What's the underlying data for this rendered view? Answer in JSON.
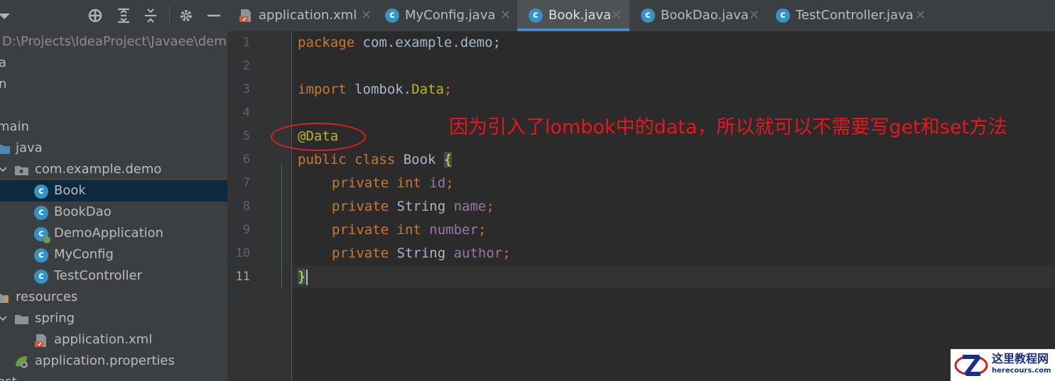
{
  "project": {
    "path": "D:\\Projects\\IdeaProject\\Javaee\\demo",
    "rows": [
      {
        "label": "a"
      },
      {
        "label": "n"
      },
      {
        "label": "main"
      },
      {
        "label": "java"
      },
      {
        "label": "com.example.demo"
      },
      {
        "label": "Book"
      },
      {
        "label": "BookDao"
      },
      {
        "label": "DemoApplication"
      },
      {
        "label": "MyConfig"
      },
      {
        "label": "TestController"
      },
      {
        "label": "resources"
      },
      {
        "label": "spring"
      },
      {
        "label": "application.xml"
      },
      {
        "label": "application.properties"
      },
      {
        "label": "est"
      }
    ]
  },
  "tabs": [
    {
      "label": "application.xml",
      "icon": "xml-file-icon"
    },
    {
      "label": "MyConfig.java",
      "icon": "java-class-icon"
    },
    {
      "label": "Book.java",
      "icon": "java-class-icon",
      "active": true
    },
    {
      "label": "BookDao.java",
      "icon": "java-class-icon"
    },
    {
      "label": "TestController.java",
      "icon": "java-class-icon"
    }
  ],
  "editor": {
    "line_numbers": [
      "1",
      "2",
      "3",
      "4",
      "5",
      "6",
      "7",
      "8",
      "9",
      "10",
      "11"
    ],
    "current_line": "11",
    "code": {
      "l1_kw": "package",
      "l1_rest": " com.example.demo;",
      "l3_kw": "import",
      "l3_mid": " lombok.",
      "l3_ann": "Data",
      "l3_end": ";",
      "l5_ann": "@Data",
      "l6_kw": "public class",
      "l6_name": " Book ",
      "l6_brace": "{",
      "l7_kw": "private int",
      "l7_fld": "id",
      "l8_kw": "private",
      "l8_type": " String ",
      "l8_fld": "name",
      "l9_kw": "private int",
      "l9_fld": "number",
      "l10_kw": "private",
      "l10_type": " String ",
      "l10_fld": "author",
      "semicolon": ";",
      "l11_brace": "}"
    }
  },
  "annotation": {
    "text": "因为引入了lombok中的data，所以就可以不需要写get和set方法",
    "color": "#e8171b"
  },
  "watermark": {
    "line1": "这里教程网",
    "line2": "herecours.com"
  },
  "colors": {
    "keyword": "#cc7832",
    "annotation": "#bbb529",
    "field": "#9876aa",
    "text": "#a9b7c6",
    "tab_underline": "#4a88c7",
    "selection": "#0d293e"
  }
}
